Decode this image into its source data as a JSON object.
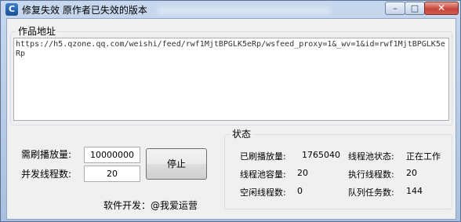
{
  "window": {
    "title": "修复失效 原作者已失效的版本",
    "icon_glyph": "C",
    "minimize_glyph": "–",
    "maximize_glyph": "□",
    "close_glyph": "✕"
  },
  "url_group": {
    "title": "作品地址",
    "url": "https://h5.qzone.qq.com/weishi/feed/rwf1MjtBPGLK5eRp/wsfeed_proxy=1&_wv=1&id=rwf1MjtBPGLK5eRp"
  },
  "controls": {
    "play_count_label": "需刷播放量:",
    "play_count_value": "10000000",
    "threads_label": "并发线程数:",
    "threads_value": "20",
    "stop_button": "停止"
  },
  "status": {
    "title": "状态",
    "played_label": "已刷播放量:",
    "played_value": "1765040",
    "pool_state_label": "线程池状态:",
    "pool_state_value": "正在工作",
    "pool_capacity_label": "线程池容量:",
    "pool_capacity_value": "20",
    "running_threads_label": "执行线程数:",
    "running_threads_value": "20",
    "idle_threads_label": "空闲线程数:",
    "idle_threads_value": "0",
    "queue_tasks_label": "队列任务数:",
    "queue_tasks_value": "144"
  },
  "footer": {
    "developer": "软件开发：@我爱运营"
  }
}
